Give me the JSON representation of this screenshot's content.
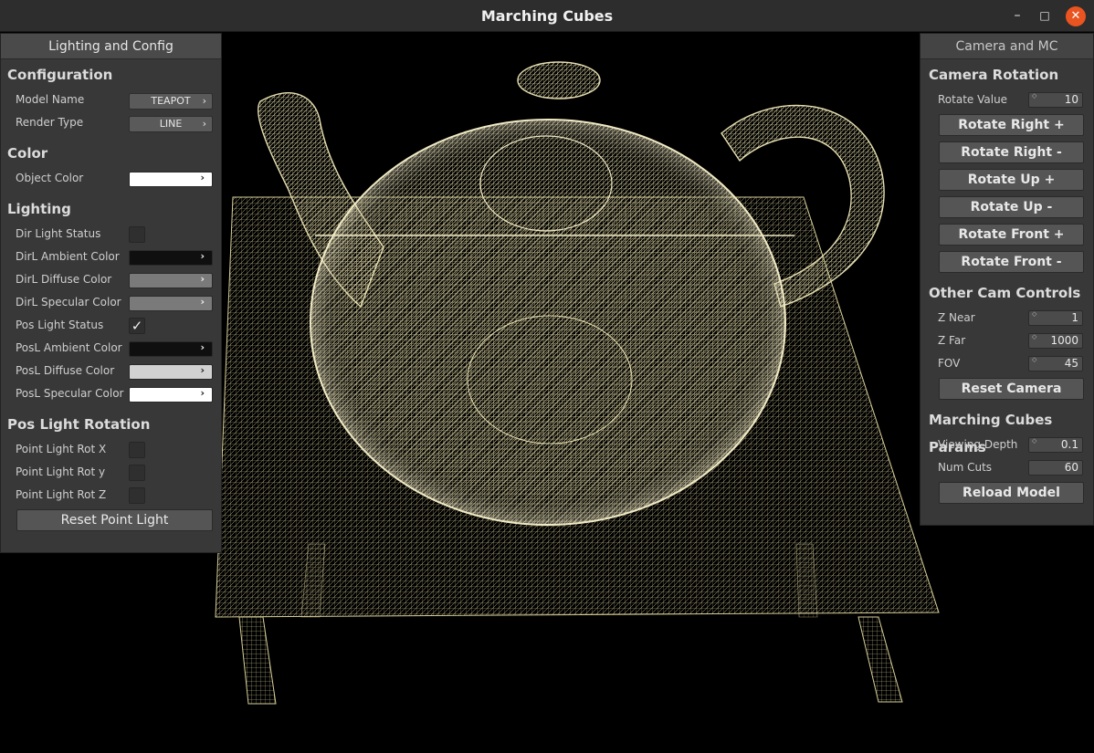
{
  "window": {
    "title": "Marching Cubes"
  },
  "window_controls": {
    "minimize": "–",
    "maximize": "□",
    "close": "✕"
  },
  "left_panel": {
    "title": "Lighting and Config",
    "config_heading": "Configuration",
    "model_name_label": "Model Name",
    "model_name_value": "TEAPOT",
    "render_type_label": "Render Type",
    "render_type_value": "LINE",
    "color_heading": "Color",
    "object_color_label": "Object Color",
    "lighting_heading": "Lighting",
    "dir_light_status_label": "Dir Light Status",
    "dir_ambient_label": "DirL Ambient Color",
    "dir_diffuse_label": "DirL Diffuse Color",
    "dir_specular_label": "DirL Specular Color",
    "pos_light_status_label": "Pos Light Status",
    "pos_ambient_label": "PosL Ambient Color",
    "pos_diffuse_label": "PosL Diffuse Color",
    "pos_specular_label": "PosL Specular Color",
    "pos_rot_heading": "Pos Light Rotation",
    "rot_x_label": "Point Light Rot X",
    "rot_y_label": "Point Light Rot y",
    "rot_z_label": "Point Light Rot Z",
    "reset_point_light": "Reset Point Light",
    "check_mark": "✓",
    "arrow": "›",
    "colors": {
      "object": "#ffffff",
      "dir_ambient": "#0f0f0f",
      "dir_diffuse": "#7a7a7a",
      "dir_specular": "#7a7a7a",
      "pos_ambient": "#0f0f0f",
      "pos_diffuse": "#d2d2d2",
      "pos_specular": "#ffffff"
    },
    "checkboxes": {
      "dir_light": false,
      "pos_light": true,
      "rot_x": false,
      "rot_y": false,
      "rot_z": false
    }
  },
  "right_panel": {
    "title": "Camera and MC",
    "cam_rot_heading": "Camera Rotation",
    "rotate_value_label": "Rotate Value",
    "rotate_value": "10",
    "rotate_right_plus": "Rotate Right +",
    "rotate_right_minus": "Rotate Right -",
    "rotate_up_plus": "Rotate Up +",
    "rotate_up_minus": "Rotate Up -",
    "rotate_front_plus": "Rotate Front +",
    "rotate_front_minus": "Rotate Front -",
    "other_heading": "Other Cam Controls",
    "z_near_label": "Z Near",
    "z_near_value": "1",
    "z_far_label": "Z Far",
    "z_far_value": "1000",
    "fov_label": "FOV",
    "fov_value": "45",
    "reset_camera": "Reset Camera",
    "mc_heading": "Marching Cubes Params",
    "viewing_depth_label": "Viewing Depth",
    "viewing_depth_value": "0.1",
    "num_cuts_label": "Num Cuts",
    "num_cuts_value": "60",
    "reload_model": "Reload Model",
    "spin_glyph": "◇"
  },
  "viewport": {
    "wire_color": "#e6dfb0",
    "model": "TEAPOT",
    "render_type": "LINE"
  }
}
